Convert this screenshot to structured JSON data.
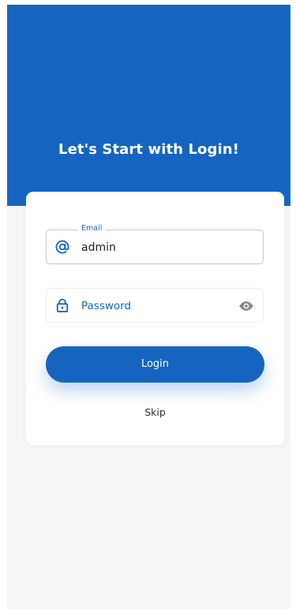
{
  "header": {
    "title": "Let's Start with Login!"
  },
  "form": {
    "email": {
      "label": "Email",
      "value": "admin",
      "icon": "at-icon"
    },
    "password": {
      "placeholder": "Password",
      "icon": "lock-icon",
      "toggle_icon": "eye-icon"
    },
    "login_label": "Login",
    "skip_label": "Skip"
  },
  "colors": {
    "primary": "#1565c0",
    "background": "#f6f6f8",
    "card": "#ffffff"
  }
}
